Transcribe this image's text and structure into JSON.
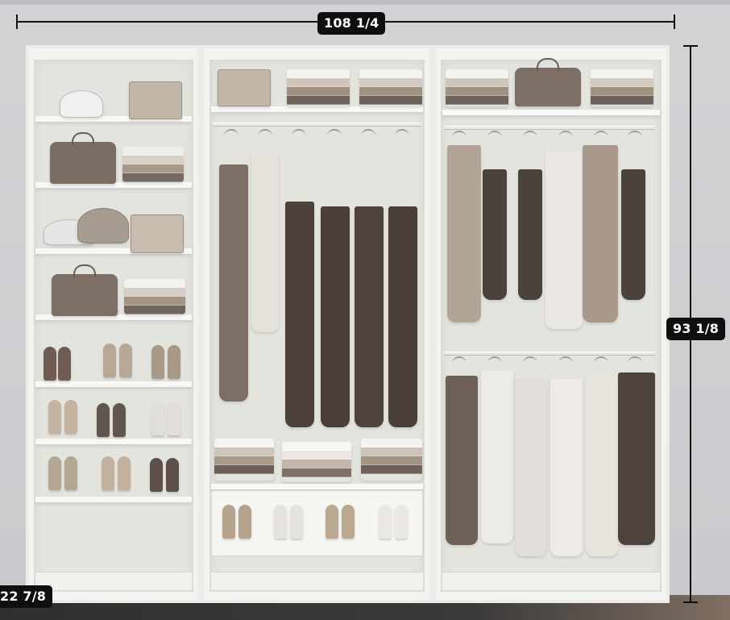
{
  "dimensions": {
    "width_label": "108 1/4",
    "height_label": "93 1/8",
    "depth_label": "22 7/8"
  },
  "colors": {
    "wall": "#cfd0d2",
    "wardrobe": "#f3f3f0",
    "interior": "#e4e4df",
    "dark_garment": "#4c423d",
    "mid_garment": "#8b7d73",
    "light_garment": "#e6e4de",
    "dimension_line": "#111111",
    "dimension_label_bg": "#0f0f10",
    "dimension_label_text": "#ffffff"
  },
  "scene": {
    "units": [
      {
        "name": "left-unit",
        "contents": [
          "hat",
          "clutch",
          "handbags",
          "folded-clothes",
          "shoes"
        ]
      },
      {
        "name": "middle-unit",
        "contents": [
          "clutch",
          "folded-clothes",
          "dresses",
          "shoes"
        ]
      },
      {
        "name": "right-unit",
        "contents": [
          "folded-clothes",
          "handbag",
          "jackets",
          "shirts"
        ]
      }
    ]
  }
}
